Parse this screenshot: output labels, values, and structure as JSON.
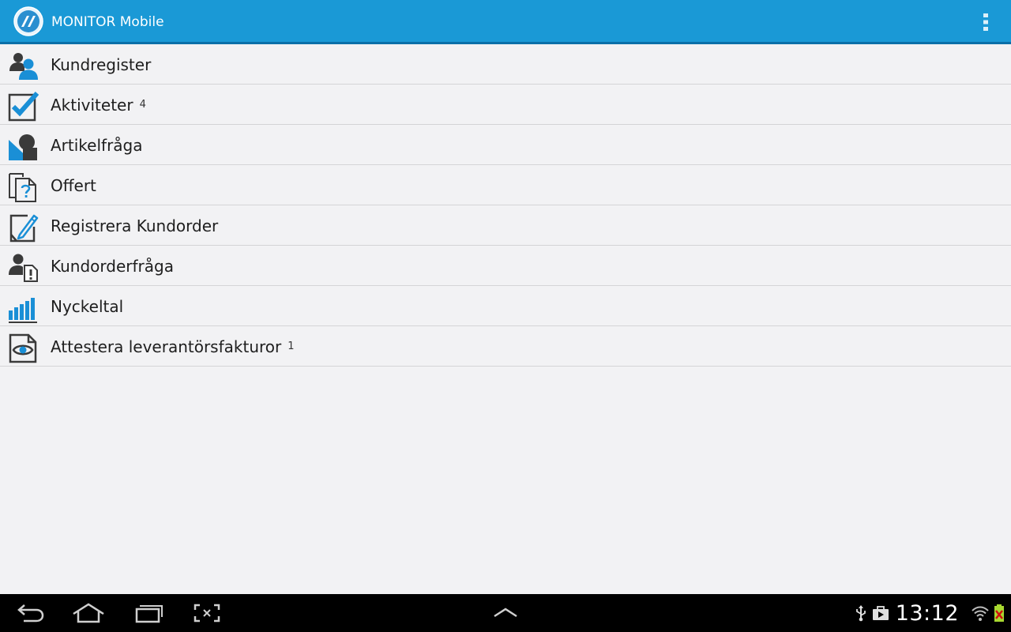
{
  "app": {
    "title": "MONITOR Mobile"
  },
  "menu": {
    "items": [
      {
        "label": "Kundregister",
        "badge": "",
        "icon": "customer-register-icon"
      },
      {
        "label": "Aktiviteter",
        "badge": "4",
        "icon": "checkbox-checked-icon"
      },
      {
        "label": "Artikelfråga",
        "badge": "",
        "icon": "article-query-icon"
      },
      {
        "label": "Offert",
        "badge": "",
        "icon": "quote-document-icon"
      },
      {
        "label": "Registrera Kundorder",
        "badge": "",
        "icon": "edit-pencil-icon"
      },
      {
        "label": "Kundorderfråga",
        "badge": "",
        "icon": "customer-order-query-icon"
      },
      {
        "label": "Nyckeltal",
        "badge": "",
        "icon": "bar-chart-icon"
      },
      {
        "label": "Attestera leverantörsfakturor",
        "badge": "1",
        "icon": "eye-document-icon"
      }
    ]
  },
  "status_bar": {
    "time": "13:12"
  },
  "colors": {
    "actionbar": "#1a99d6",
    "actionbar_border": "#0b6fa8",
    "background": "#f2f2f4",
    "icon_blue": "#1a8fd6",
    "icon_dark": "#3a3a3a"
  }
}
